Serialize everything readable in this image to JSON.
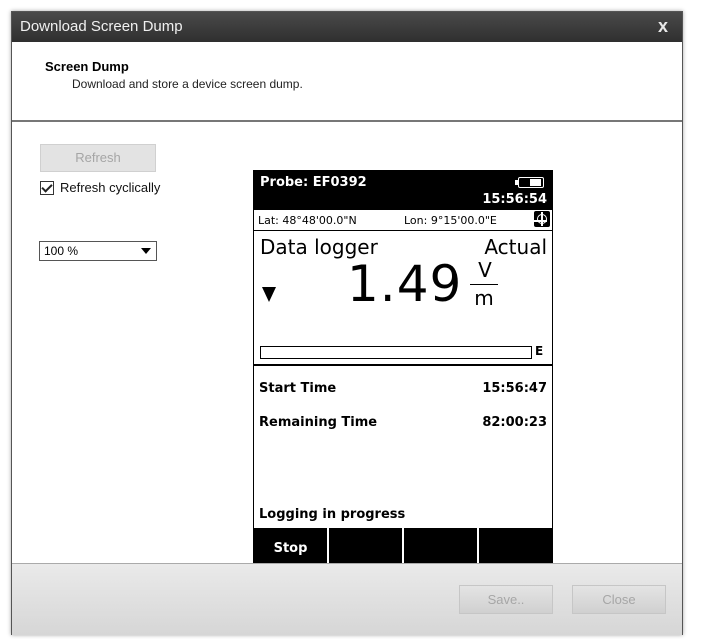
{
  "window": {
    "title": "Download Screen Dump",
    "close_glyph": "x"
  },
  "header": {
    "title": "Screen Dump",
    "subtitle": "Download and store a device screen dump."
  },
  "controls": {
    "refresh_label": "Refresh",
    "refresh_cyclically_label": "Refresh cyclically",
    "refresh_cyclically_checked": true,
    "zoom_value": "100 %"
  },
  "device": {
    "probe": "Probe: EF0392",
    "time": "15:56:54",
    "lat": "Lat:  48°48'00.0\"N",
    "lon": "Lon:  9°15'00.0\"E",
    "mode": "Data logger",
    "mode_right": "Actual",
    "reading": "1.49",
    "unit_numerator": "V",
    "unit_denominator": "m",
    "bar_end_label": "E",
    "start_time_label": "Start Time",
    "start_time_value": "15:56:47",
    "remaining_time_label": "Remaining Time",
    "remaining_time_value": "82:00:23",
    "status": "Logging in progress",
    "softkeys": [
      "Stop",
      "",
      "",
      ""
    ]
  },
  "footer": {
    "save_label": "Save..",
    "close_label": "Close"
  },
  "icons": [
    "battery-icon",
    "gps-icon",
    "down-arrow-icon",
    "checkmark-icon",
    "dropdown-arrow-icon"
  ]
}
